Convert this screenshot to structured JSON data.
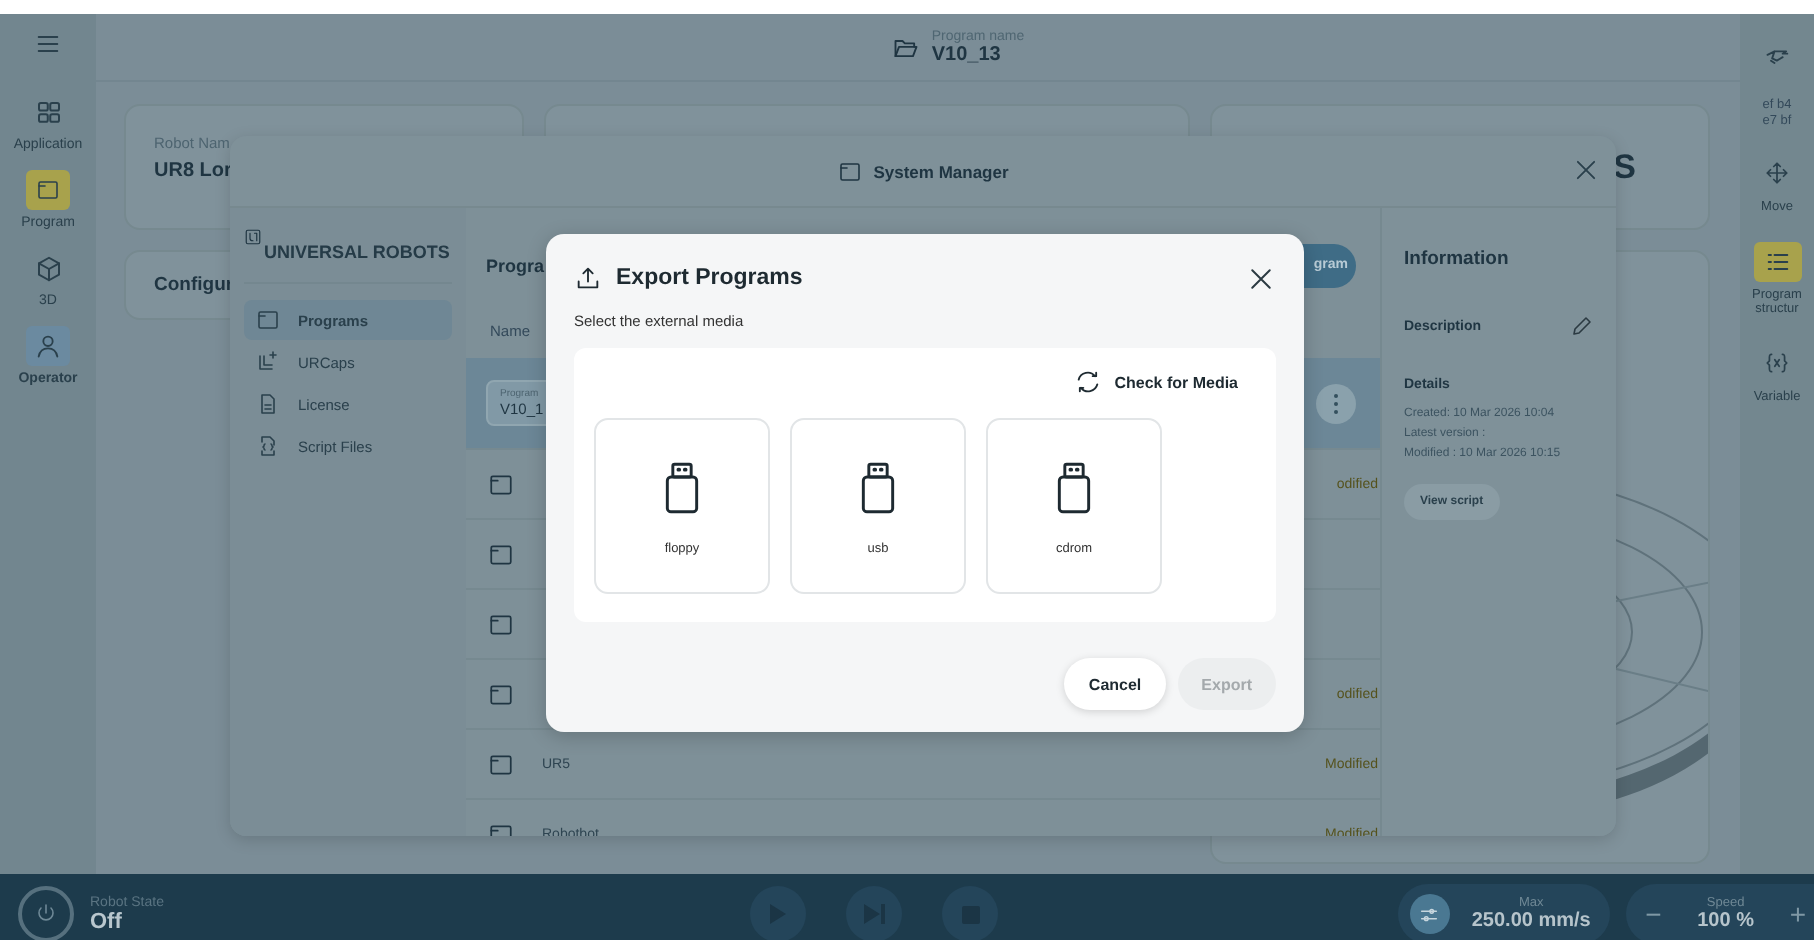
{
  "left_rail": {
    "items": [
      {
        "label": "Application",
        "kind": "nav",
        "selected": false
      },
      {
        "label": "Program",
        "kind": "nav",
        "selected": true
      },
      {
        "label": "3D",
        "kind": "nav",
        "selected": false
      },
      {
        "label": "Operator",
        "kind": "role",
        "selected": false
      }
    ]
  },
  "header": {
    "program_label": "Program name",
    "program_name": "V10_13"
  },
  "right_rail": {
    "code_lines": [
      "ef b4",
      "e7 bf"
    ],
    "items": [
      {
        "label": "Move",
        "selected": false
      },
      {
        "label": "Program structur",
        "selected": true
      },
      {
        "label": "Variable",
        "selected": false
      }
    ]
  },
  "cards": {
    "robot_label": "Robot Nam",
    "robot_name": "UR8 Lor",
    "config_title": "Configur",
    "side_title": "S"
  },
  "system_manager": {
    "title": "System Manager",
    "logo": "UNIVERSAL ROBOTS",
    "nav": [
      {
        "label": "Programs",
        "selected": true
      },
      {
        "label": "URCaps",
        "selected": false
      },
      {
        "label": "License",
        "selected": false
      },
      {
        "label": "Script Files",
        "selected": false
      }
    ],
    "list_title": "Progra",
    "new_button": "gram",
    "column": "Name",
    "rows": [
      {
        "selected": true,
        "field_label": "Program",
        "field_value": "V10_1"
      },
      {
        "selected": false,
        "status": "odified"
      },
      {
        "selected": false
      },
      {
        "selected": false
      },
      {
        "selected": false,
        "status": "odified"
      },
      {
        "selected": false,
        "name": "UR5",
        "status": "Modified"
      },
      {
        "selected": false,
        "name": "Robotbot",
        "status": "Modified"
      }
    ],
    "info": {
      "title": "Information",
      "description": "Description",
      "details": "Details",
      "lines": [
        "Created: 10 Mar 2026 10:04",
        "Latest version :",
        "Modified : 10 Mar 2026 10:15"
      ],
      "view_script": "View script"
    }
  },
  "export_dialog": {
    "title": "Export Programs",
    "subtitle": "Select the external media",
    "check_media": "Check for Media",
    "media": [
      {
        "label": "floppy"
      },
      {
        "label": "usb"
      },
      {
        "label": "cdrom"
      }
    ],
    "cancel": {
      "label": "Cancel"
    },
    "export": {
      "label": "Export",
      "disabled": true
    }
  },
  "status_bar": {
    "state_label": "Robot State",
    "state": "Off",
    "max_label": "Max",
    "max_value": "250.00 mm/s",
    "speed_label": "Speed",
    "speed_value": "100 %",
    "minus": "−",
    "plus": "+"
  }
}
